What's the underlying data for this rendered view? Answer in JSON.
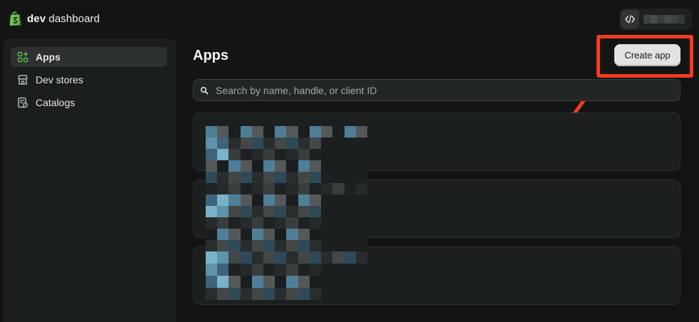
{
  "brand": {
    "bold": "dev",
    "rest": " dashboard"
  },
  "header": {
    "code_icon": "code-brackets-icon"
  },
  "sidebar": {
    "items": [
      {
        "label": "Apps",
        "icon": "apps-grid-icon",
        "active": true
      },
      {
        "label": "Dev stores",
        "icon": "store-icon",
        "active": false
      },
      {
        "label": "Catalogs",
        "icon": "catalog-icon",
        "active": false
      }
    ]
  },
  "main": {
    "title": "Apps",
    "create_button": "Create app",
    "search": {
      "placeholder": "Search by name, handle, or client ID",
      "icon": "search-icon"
    }
  },
  "colors": {
    "background": "#131515",
    "sidebar": "#1b1e1f",
    "accent_green": "#5cbf3f",
    "annotation_red": "#f43b1f"
  }
}
